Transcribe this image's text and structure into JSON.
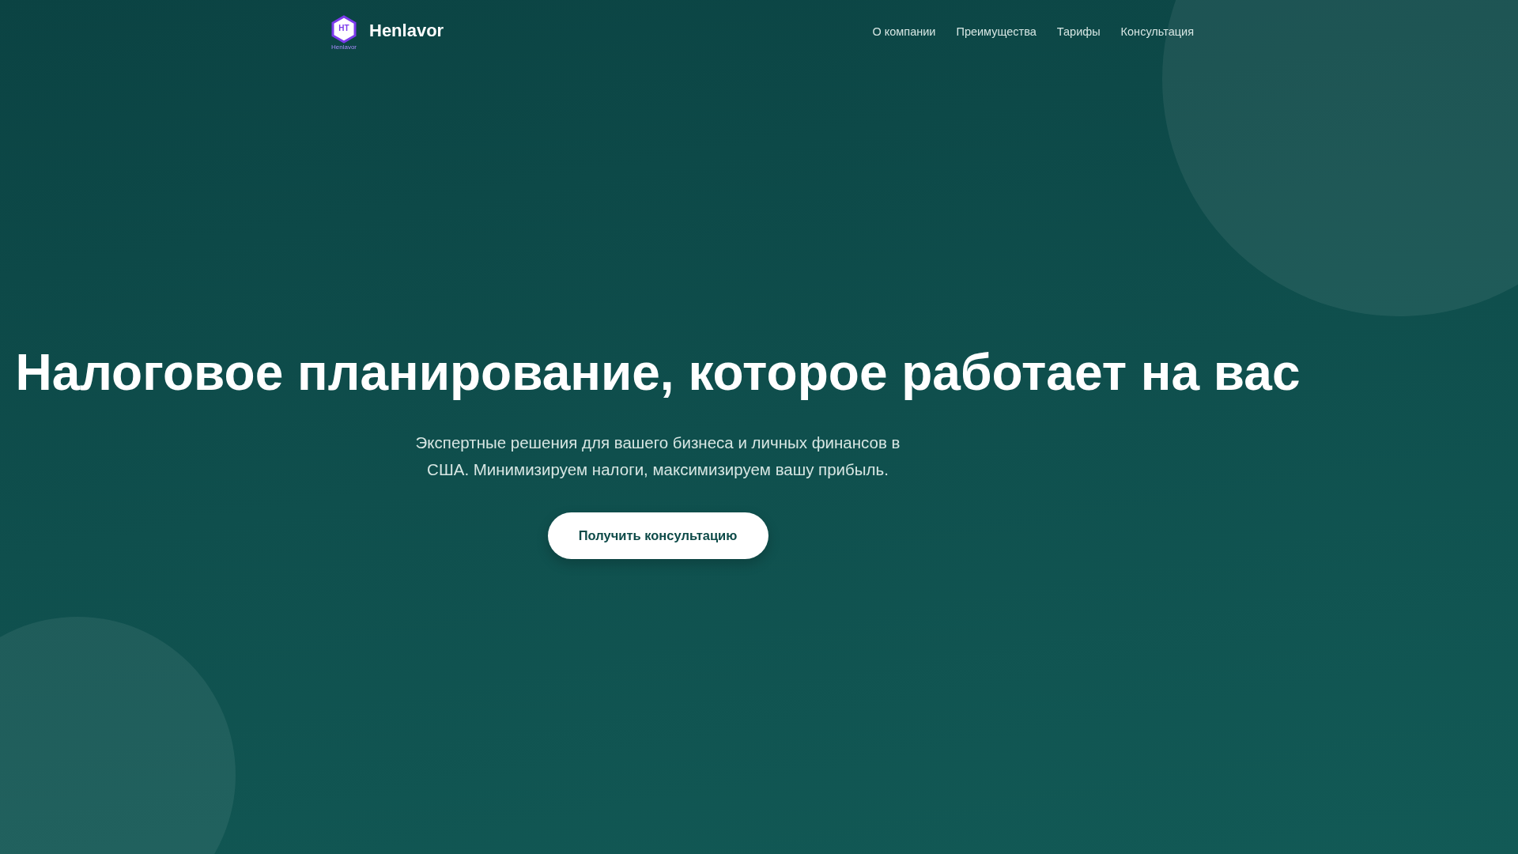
{
  "header": {
    "logo": {
      "mark": "HT",
      "caption": "Henlavor"
    },
    "brand": "Henlavor",
    "nav": [
      {
        "label": "О компании"
      },
      {
        "label": "Преимущества"
      },
      {
        "label": "Тарифы"
      },
      {
        "label": "Консультация"
      }
    ]
  },
  "hero": {
    "title": "Налоговое планирование, которое работает на вас",
    "subtitle": "Экспертные решения для вашего бизнеса и личных финансов в США. Минимизируем налоги, максимизируем вашу прибыль.",
    "button": "Получить консультацию"
  }
}
